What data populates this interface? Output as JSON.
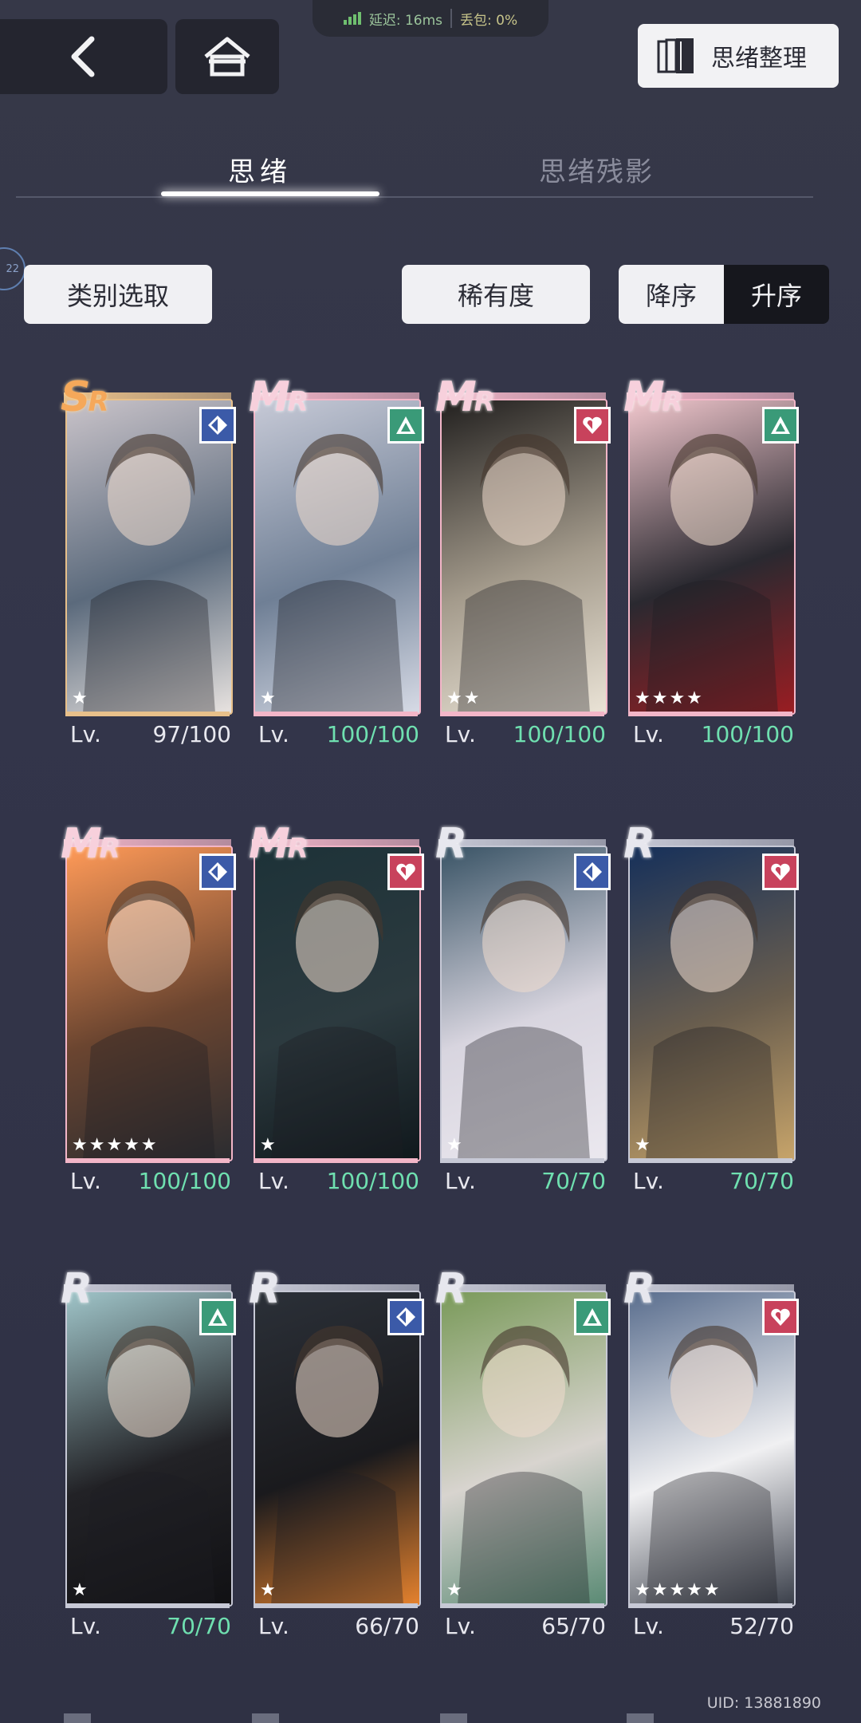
{
  "network": {
    "latency": "延迟: 16ms",
    "loss": "丢包: 0%"
  },
  "top": {
    "sort_button": "思绪整理"
  },
  "tabs": [
    {
      "label": "思绪"
    },
    {
      "label": "思绪残影"
    }
  ],
  "side_badge": "22",
  "filters": {
    "category": "类别选取",
    "rarity": "稀有度",
    "desc": "降序",
    "asc": "升序"
  },
  "level_prefix": "Lv.",
  "colors": {
    "level_max": "#6fe0b0",
    "level_normal": "#e8e8ef"
  },
  "cards": [
    {
      "rarity": "SR",
      "attr": "diamond",
      "stars": "★",
      "level": "97/100",
      "maxed": false,
      "bg": [
        "#c9c3c9",
        "#5b6a7c",
        "#e8e3e0"
      ],
      "frame": "#e8c08a"
    },
    {
      "rarity": "MR",
      "attr": "triangle",
      "stars": "★",
      "level": "100/100",
      "maxed": true,
      "bg": [
        "#c6c9d6",
        "#6f7f95",
        "#d7dbe6"
      ],
      "frame": "#f3b6c8"
    },
    {
      "rarity": "MR",
      "attr": "heart",
      "stars": "★★",
      "level": "100/100",
      "maxed": true,
      "bg": [
        "#22201f",
        "#a49b8c",
        "#eae3d6"
      ],
      "frame": "#f3b6c8"
    },
    {
      "rarity": "MR",
      "attr": "triangle",
      "stars": "★★★★",
      "level": "100/100",
      "maxed": true,
      "bg": [
        "#f0c6cc",
        "#2a2930",
        "#9a1d22"
      ],
      "frame": "#f3b6c8"
    },
    {
      "rarity": "MR",
      "attr": "diamond",
      "stars": "★★★★★",
      "level": "100/100",
      "maxed": true,
      "bg": [
        "#ff9a58",
        "#6b4530",
        "#2b2c30"
      ],
      "frame": "#f3b6c8"
    },
    {
      "rarity": "MR",
      "attr": "heart",
      "stars": "★",
      "level": "100/100",
      "maxed": true,
      "bg": [
        "#1d3238",
        "#2c3a3f",
        "#10181c"
      ],
      "frame": "#f3b6c8"
    },
    {
      "rarity": "R",
      "attr": "diamond",
      "stars": "★",
      "level": "70/70",
      "maxed": true,
      "bg": [
        "#3a5466",
        "#d8d5df",
        "#ebe8ef"
      ],
      "frame": "#c7c9d6"
    },
    {
      "rarity": "R",
      "attr": "heart",
      "stars": "★",
      "level": "70/70",
      "maxed": true,
      "bg": [
        "#16305a",
        "#6a5e4e",
        "#c7a46a"
      ],
      "frame": "#c7c9d6"
    },
    {
      "rarity": "R",
      "attr": "triangle",
      "stars": "★",
      "level": "70/70",
      "maxed": true,
      "bg": [
        "#9fc4c8",
        "#222226",
        "#111114"
      ],
      "frame": "#c7c9d6"
    },
    {
      "rarity": "R",
      "attr": "diamond",
      "stars": "★",
      "level": "66/70",
      "maxed": false,
      "bg": [
        "#2b3038",
        "#1a1a1d",
        "#e5822e"
      ],
      "frame": "#c7c9d6"
    },
    {
      "rarity": "R",
      "attr": "triangle",
      "stars": "★",
      "level": "65/70",
      "maxed": false,
      "bg": [
        "#7a9a5a",
        "#d8d4cf",
        "#5a8a74"
      ],
      "frame": "#c7c9d6"
    },
    {
      "rarity": "R",
      "attr": "heart",
      "stars": "★★★★★",
      "level": "52/70",
      "maxed": false,
      "bg": [
        "#5a6e8e",
        "#f0f0f2",
        "#3a3f4a"
      ],
      "frame": "#c7c9d6"
    }
  ],
  "uid": "UID: 13881890"
}
